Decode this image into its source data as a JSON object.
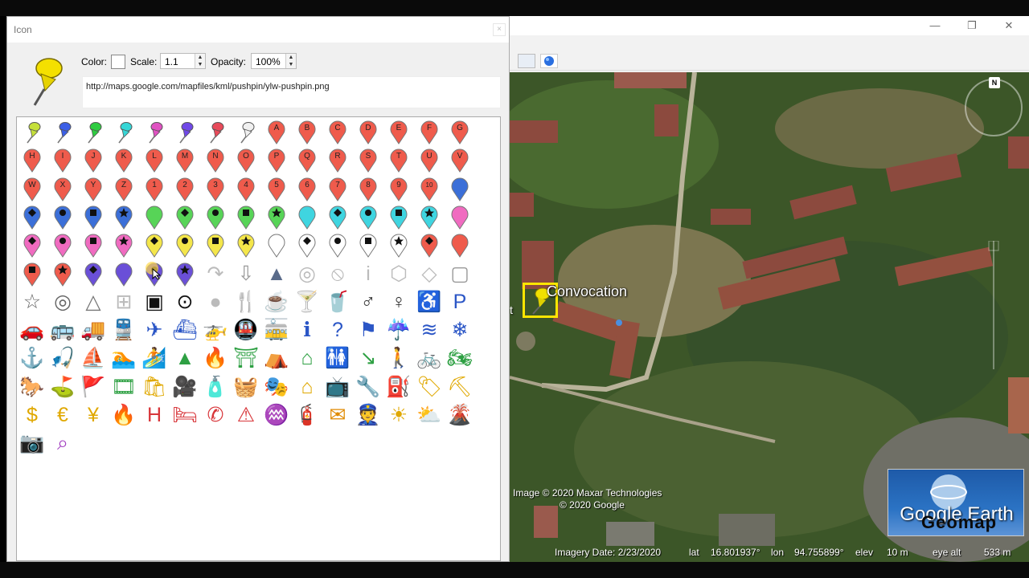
{
  "dialog": {
    "title": "Icon",
    "close_glyph": "×",
    "color_label": "Color:",
    "scale_label": "Scale:",
    "scale_value": "1.1",
    "opacity_label": "Opacity:",
    "opacity_value": "100%",
    "icon_url": "http://maps.google.com/mapfiles/kml/pushpin/ylw-pushpin.png",
    "selected_color": "#ffffff"
  },
  "pushpins": [
    "#c5e03a",
    "#3b5fe6",
    "#2ecc40",
    "#36d6d6",
    "#e052c2",
    "#7048e8",
    "#e84a5a",
    "#f0f0f0"
  ],
  "paddle_rows": [
    {
      "color": "#ef5b4c",
      "labels": [
        "A",
        "B",
        "C",
        "D",
        "E",
        "F",
        "G"
      ]
    },
    {
      "color": "#ef5b4c",
      "labels": [
        "H",
        "I",
        "J",
        "K",
        "L",
        "M",
        "N",
        "O",
        "P",
        "Q",
        "R",
        "S",
        "T",
        "U",
        "V"
      ]
    },
    {
      "color": "#ef5b4c",
      "labels": [
        "W",
        "X",
        "Y",
        "Z",
        "1",
        "2",
        "3",
        "4",
        "5",
        "6",
        "7",
        "8",
        "9",
        "10"
      ]
    }
  ],
  "shape_paddles": [
    [
      {
        "c": "#3b6fd8",
        "m": "diamond"
      },
      {
        "c": "#3b6fd8",
        "m": "circle"
      },
      {
        "c": "#3b6fd8",
        "m": "square"
      },
      {
        "c": "#3b6fd8",
        "m": "star"
      },
      {
        "c": "#57d457",
        "m": ""
      },
      {
        "c": "#57d457",
        "m": "diamond"
      },
      {
        "c": "#57d457",
        "m": "circle"
      },
      {
        "c": "#57d457",
        "m": "square"
      },
      {
        "c": "#57d457",
        "m": "star"
      },
      {
        "c": "#3fd5e0",
        "m": ""
      },
      {
        "c": "#3fd5e0",
        "m": "diamond"
      },
      {
        "c": "#3fd5e0",
        "m": "circle"
      },
      {
        "c": "#3fd5e0",
        "m": "square"
      },
      {
        "c": "#3fd5e0",
        "m": "star"
      },
      {
        "c": "#f06bc0",
        "m": ""
      }
    ],
    [
      {
        "c": "#f06bc0",
        "m": "diamond"
      },
      {
        "c": "#f06bc0",
        "m": "circle"
      },
      {
        "c": "#f06bc0",
        "m": "square"
      },
      {
        "c": "#f06bc0",
        "m": "star"
      },
      {
        "c": "#f4e64a",
        "m": "diamond"
      },
      {
        "c": "#f4e64a",
        "m": "circle"
      },
      {
        "c": "#f4e64a",
        "m": "square"
      },
      {
        "c": "#f4e64a",
        "m": "star"
      },
      {
        "c": "#ffffff",
        "m": ""
      },
      {
        "c": "#ffffff",
        "m": "diamond"
      },
      {
        "c": "#ffffff",
        "m": "circle"
      },
      {
        "c": "#ffffff",
        "m": "square"
      },
      {
        "c": "#ffffff",
        "m": "star"
      },
      {
        "c": "#ef5b4c",
        "m": "diamond"
      },
      {
        "c": "#ef5b4c",
        "m": ""
      }
    ],
    [
      {
        "c": "#ef5b4c",
        "m": "square"
      },
      {
        "c": "#ef5b4c",
        "m": "star"
      },
      {
        "c": "#6a4fd8",
        "m": "diamond"
      },
      {
        "c": "#6a4fd8",
        "m": ""
      },
      {
        "c": "#6a4fd8",
        "m": "circle"
      },
      {
        "c": "#6a4fd8",
        "m": "star"
      }
    ]
  ],
  "row6_shapes": [
    {
      "name": "arrow-reroute-icon",
      "g": "↷",
      "col": "#bbb"
    },
    {
      "name": "arrow-down-icon",
      "g": "⇩",
      "col": "#999"
    },
    {
      "name": "arrow-nav-icon",
      "g": "▲",
      "col": "#5a6b8a"
    },
    {
      "name": "target-ring-icon",
      "g": "◎",
      "col": "#bbb"
    },
    {
      "name": "forbidden-icon",
      "g": "⦸",
      "col": "#bbb"
    },
    {
      "name": "info-i-icon",
      "g": "i",
      "col": "#bbb"
    },
    {
      "name": "hexagon-icon",
      "g": "⬡",
      "col": "#bbb"
    },
    {
      "name": "diamond-outline-icon",
      "g": "◇",
      "col": "#bbb"
    },
    {
      "name": "square-outline-icon",
      "g": "▢",
      "col": "#999"
    }
  ],
  "symbol_rows": [
    [
      {
        "n": "star-icon",
        "g": "☆",
        "c": "#666"
      },
      {
        "n": "target-icon",
        "g": "◎",
        "c": "#666"
      },
      {
        "n": "triangle-icon",
        "g": "△",
        "c": "#777"
      },
      {
        "n": "crosshair-square-icon",
        "g": "⊞",
        "c": "#bbb"
      },
      {
        "n": "small-square-icon",
        "g": "▣",
        "c": "#111"
      },
      {
        "n": "dot-circle-icon",
        "g": "⊙",
        "c": "#111"
      },
      {
        "n": "gray-dot-icon",
        "g": "●",
        "c": "#bbb"
      },
      {
        "n": "dining-icon",
        "g": "🍴",
        "c": "#333"
      },
      {
        "n": "coffee-icon",
        "g": "☕",
        "c": "#333"
      },
      {
        "n": "bar-icon",
        "g": "🍸",
        "c": "#333"
      },
      {
        "n": "snack-icon",
        "g": "🥤",
        "c": "#333"
      },
      {
        "n": "man-icon",
        "g": "♂",
        "c": "#333"
      },
      {
        "n": "woman-icon",
        "g": "♀",
        "c": "#333"
      },
      {
        "n": "wheelchair-icon",
        "g": "♿",
        "c": "#2b56c6"
      },
      {
        "n": "parking-icon",
        "g": "P",
        "c": "#2b56c6"
      }
    ],
    [
      {
        "n": "car-icon",
        "g": "🚗",
        "c": "#2b56c6"
      },
      {
        "n": "bus-icon",
        "g": "🚌",
        "c": "#2b56c6"
      },
      {
        "n": "truck-icon",
        "g": "🚚",
        "c": "#2b56c6"
      },
      {
        "n": "rail-icon",
        "g": "🚆",
        "c": "#2b56c6"
      },
      {
        "n": "airport-icon",
        "g": "✈",
        "c": "#2b56c6"
      },
      {
        "n": "ferry-icon",
        "g": "⛴",
        "c": "#2b56c6"
      },
      {
        "n": "helicopter-icon",
        "g": "🚁",
        "c": "#2b56c6"
      },
      {
        "n": "subway-icon",
        "g": "🚇",
        "c": "#2b56c6"
      },
      {
        "n": "tram-icon",
        "g": "🚋",
        "c": "#2b56c6"
      },
      {
        "n": "info-icon",
        "g": "ℹ",
        "c": "#2b56c6"
      },
      {
        "n": "question-icon",
        "g": "?",
        "c": "#2b56c6"
      },
      {
        "n": "flag-icon",
        "g": "⚑",
        "c": "#2b56c6"
      },
      {
        "n": "rain-icon",
        "g": "☔",
        "c": "#2b56c6"
      },
      {
        "n": "water-icon",
        "g": "≋",
        "c": "#2b56c6"
      },
      {
        "n": "snowflake-icon",
        "g": "❄",
        "c": "#2b56c6"
      }
    ],
    [
      {
        "n": "marina-icon",
        "g": "⚓",
        "c": "#2b56c6"
      },
      {
        "n": "fishing-icon",
        "g": "🎣",
        "c": "#2b56c6"
      },
      {
        "n": "sailing-icon",
        "g": "⛵",
        "c": "#2b56c6"
      },
      {
        "n": "swimming-icon",
        "g": "🏊",
        "c": "#2b56c6"
      },
      {
        "n": "water-ski-icon",
        "g": "🏄",
        "c": "#2b56c6"
      },
      {
        "n": "tree-icon",
        "g": "▲",
        "c": "#2ea043"
      },
      {
        "n": "campfire-icon",
        "g": "🔥",
        "c": "#2ea043"
      },
      {
        "n": "picnic-icon",
        "g": "⛩",
        "c": "#2ea043"
      },
      {
        "n": "camping-icon",
        "g": "⛺",
        "c": "#2ea043"
      },
      {
        "n": "ranger-icon",
        "g": "⌂",
        "c": "#2ea043"
      },
      {
        "n": "toilets-icon",
        "g": "🚻",
        "c": "#2ea043"
      },
      {
        "n": "trail-arrow-icon",
        "g": "↘",
        "c": "#2ea043"
      },
      {
        "n": "hiking-icon",
        "g": "🚶",
        "c": "#2ea043"
      },
      {
        "n": "cycling-icon",
        "g": "🚲",
        "c": "#2ea043"
      },
      {
        "n": "motorbike-icon",
        "g": "🏍",
        "c": "#2ea043"
      }
    ],
    [
      {
        "n": "horse-icon",
        "g": "🐎",
        "c": "#2ea043"
      },
      {
        "n": "golf-icon",
        "g": "⛳",
        "c": "#2ea043"
      },
      {
        "n": "trail-icon",
        "g": "🚩",
        "c": "#2ea043"
      },
      {
        "n": "movies-icon",
        "g": "🎞",
        "c": "#2ea043"
      },
      {
        "n": "shopping-icon",
        "g": "🛍",
        "c": "#e0a800"
      },
      {
        "n": "camera-film-icon",
        "g": "🎥",
        "c": "#e0a800"
      },
      {
        "n": "convenience-icon",
        "g": "🧴",
        "c": "#e0a800"
      },
      {
        "n": "grocery-icon",
        "g": "🧺",
        "c": "#e0a800"
      },
      {
        "n": "arts-icon",
        "g": "🎭",
        "c": "#e0a800"
      },
      {
        "n": "homegardening-icon",
        "g": "⌂",
        "c": "#e0a800"
      },
      {
        "n": "electronics-icon",
        "g": "📺",
        "c": "#e0a800"
      },
      {
        "n": "mechanic-icon",
        "g": "🔧",
        "c": "#e0a800"
      },
      {
        "n": "gas-station-icon",
        "g": "⛽",
        "c": "#e0a800"
      },
      {
        "n": "realestate-icon",
        "g": "🏷",
        "c": "#e0a800"
      },
      {
        "n": "poi-icon",
        "g": "⛏",
        "c": "#e0a800"
      }
    ],
    [
      {
        "n": "dollar-icon",
        "g": "$",
        "c": "#e0a800"
      },
      {
        "n": "euro-icon",
        "g": "€",
        "c": "#e0a800"
      },
      {
        "n": "yen-icon",
        "g": "¥",
        "c": "#e0a800"
      },
      {
        "n": "fire-icon",
        "g": "🔥",
        "c": "#d8363a"
      },
      {
        "n": "hospital-icon",
        "g": "H",
        "c": "#d8363a"
      },
      {
        "n": "lodging-icon",
        "g": "🛏",
        "c": "#d8363a"
      },
      {
        "n": "phone-icon",
        "g": "✆",
        "c": "#d8363a"
      },
      {
        "n": "caution-icon",
        "g": "⚠",
        "c": "#d8363a"
      },
      {
        "n": "earthquake-icon",
        "g": "♒",
        "c": "#d8363a"
      },
      {
        "n": "firedept-icon",
        "g": "🧯",
        "c": "#d8363a"
      },
      {
        "n": "post-office-icon",
        "g": "✉",
        "c": "#e08a00"
      },
      {
        "n": "police-icon",
        "g": "👮",
        "c": "#e08a00"
      },
      {
        "n": "sunny-icon",
        "g": "☀",
        "c": "#e0a800"
      },
      {
        "n": "partly-cloudy-icon",
        "g": "⛅",
        "c": "#e0a800"
      },
      {
        "n": "volcano-icon",
        "g": "🌋",
        "c": "#e05a1a"
      }
    ],
    [
      {
        "n": "camera-icon",
        "g": "📷",
        "c": "#a23fc0"
      },
      {
        "n": "webcam-icon",
        "g": "⌕",
        "c": "#a23fc0"
      }
    ]
  ],
  "map": {
    "placemark_label": "Convocation",
    "side_label": "t",
    "attribution_1": "Image © 2020 Maxar Technologies",
    "attribution_2": "© 2020 Google",
    "imagery_date": "Imagery Date: 2/23/2020",
    "lat_label": "lat",
    "lat_value": "16.801937°",
    "lon_label": "lon",
    "lon_value": "94.755899°",
    "elev_label": "elev",
    "elev_value": "10 m",
    "eye_label": "eye alt",
    "eye_value": "533 m",
    "logo_text": "Google Earth",
    "watermark": "Geomap",
    "compass_n": "N"
  },
  "window": {
    "minimize": "—",
    "restore": "❐",
    "close": "✕"
  }
}
